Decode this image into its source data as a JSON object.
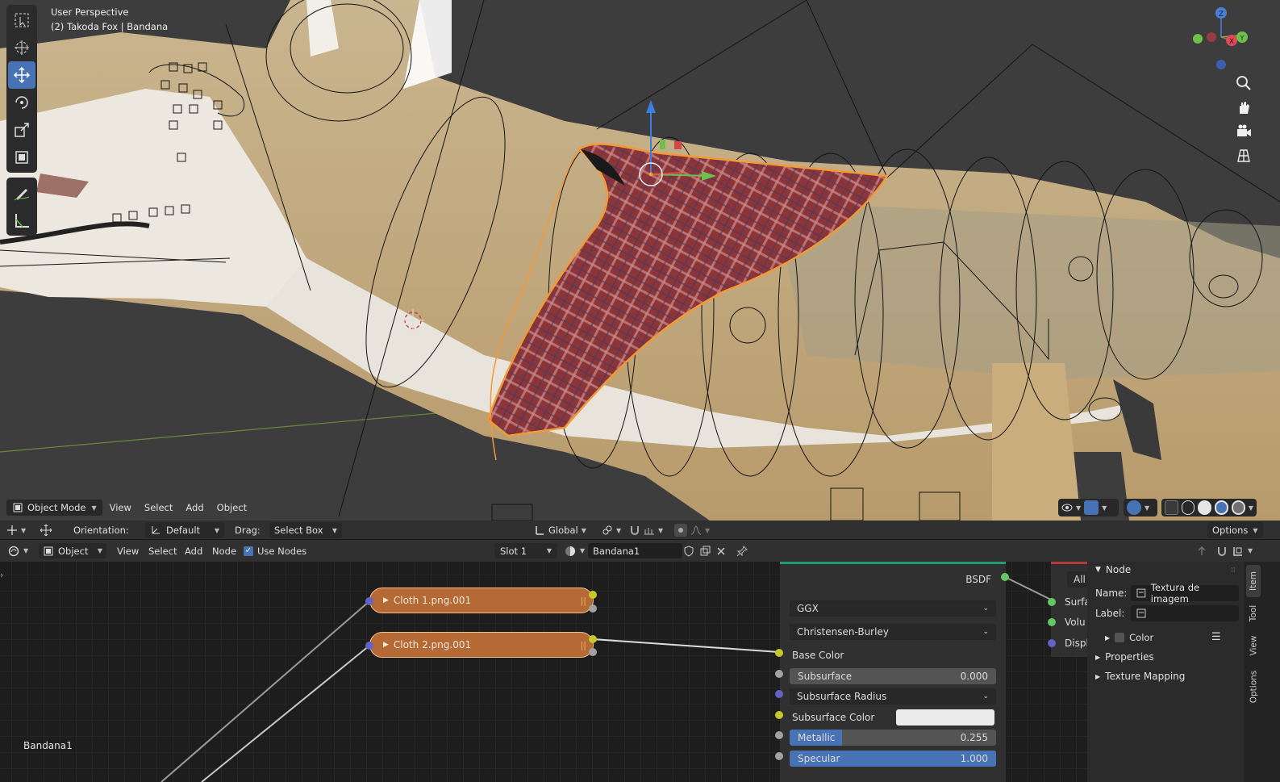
{
  "viewport": {
    "title": "User Perspective",
    "subtitle": "(2) Takoda Fox | Bandana",
    "mode_label": "Object Mode",
    "menu": [
      "View",
      "Select",
      "Add",
      "Object"
    ]
  },
  "tool_settings": {
    "orientation_label": "Orientation:",
    "orientation_value": "Default",
    "drag_label": "Drag:",
    "drag_value": "Select Box",
    "transform_space": "Global",
    "options_label": "Options"
  },
  "node_header": {
    "object_type": "Object",
    "menu": [
      "View",
      "Select",
      "Add",
      "Node"
    ],
    "use_nodes_label": "Use Nodes",
    "slot": "Slot 1",
    "material": "Bandana1"
  },
  "node_canvas": {
    "material_name": "Bandana1",
    "texture_nodes": [
      "Cloth 1.png.001",
      "Cloth 2.png.001"
    ]
  },
  "bsdf": {
    "output_label": "BSDF",
    "distribution": "GGX",
    "subsurface_method": "Christensen-Burley",
    "base_color_label": "Base Color",
    "subsurface_label": "Subsurface",
    "subsurface_value": "0.000",
    "subsurface_radius_label": "Subsurface Radius",
    "subsurface_color_label": "Subsurface Color",
    "metallic_label": "Metallic",
    "metallic_value": "0.255",
    "metallic_fraction": 0.255,
    "specular_label": "Specular",
    "specular_value": "1.000",
    "specular_fraction": 1.0
  },
  "material_output": {
    "target": "All",
    "inputs": [
      "Surfa",
      "Volu",
      "Displ"
    ]
  },
  "side_panel": {
    "section": "Node",
    "name_label": "Name:",
    "name_value": "Textura de imagem",
    "label_label": "Label:",
    "label_value": "",
    "color_label": "Color",
    "properties_label": "Properties",
    "texture_mapping_label": "Texture Mapping",
    "tabs": [
      "Item",
      "Tool",
      "View",
      "Options"
    ]
  },
  "colors": {
    "accent": "#4772b3",
    "selection_outline": "#f39a37",
    "texture_node": "#b56a35",
    "shader_header": "#1f9e6b",
    "output_header": "#b43a3a"
  }
}
